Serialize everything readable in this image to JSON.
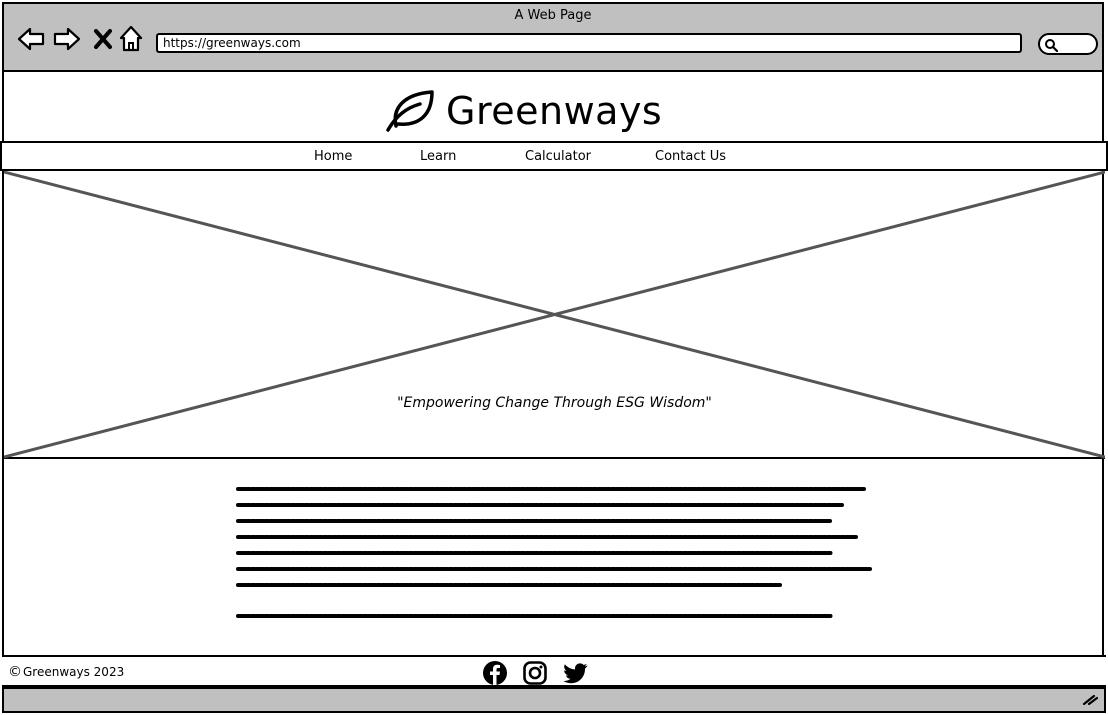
{
  "window": {
    "title": "A Web Page"
  },
  "browser": {
    "url": "https://greenways.com",
    "icons": [
      "back-arrow-icon",
      "forward-arrow-icon",
      "close-icon",
      "home-icon",
      "search-icon"
    ]
  },
  "header": {
    "logo_text": "Greenways",
    "logo_icon": "leaf-icon"
  },
  "nav": {
    "items": [
      {
        "label": "Home"
      },
      {
        "label": "Learn"
      },
      {
        "label": "Calculator"
      },
      {
        "label": "Contact Us"
      }
    ]
  },
  "hero": {
    "tagline": "\"Empowering Change Through ESG Wisdom\""
  },
  "footer": {
    "copyright": "Greenways 2023",
    "social_icons": [
      "facebook-icon",
      "instagram-icon",
      "twitter-icon"
    ]
  },
  "colors": {
    "chrome": "#c0c0c0",
    "placeholder_lines": "#555555"
  }
}
